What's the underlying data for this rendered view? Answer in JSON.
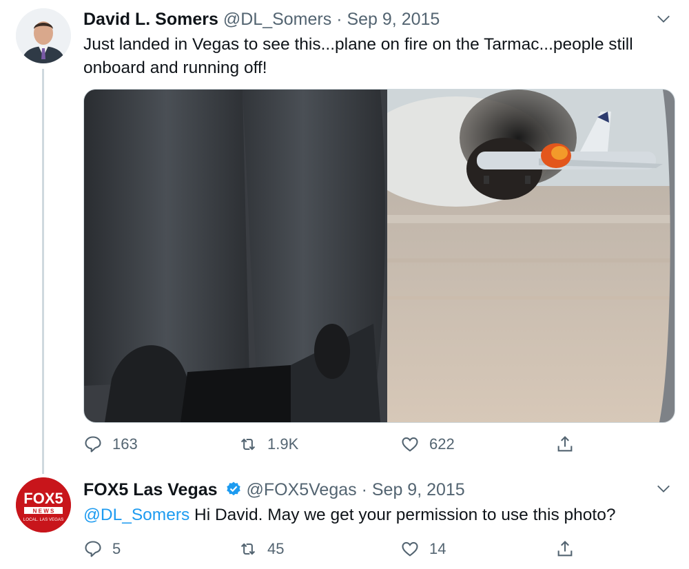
{
  "tweets": [
    {
      "author_name": "David L. Somers",
      "handle": "@DL_Somers",
      "separator": "·",
      "date": "Sep 9, 2015",
      "text": "Just landed in Vegas to see this...plane on fire on the Tarmac...people still onboard and running off!",
      "media_icon": "photo",
      "replies": "163",
      "retweets": "1.9K",
      "likes": "622"
    },
    {
      "author_name": "FOX5 Las Vegas",
      "verified_icon": "verified-badge-icon",
      "handle": "@FOX5Vegas",
      "separator": "·",
      "date": "Sep 9, 2015",
      "mention": "@DL_Somers",
      "text": " Hi David. May we get your permission to use this photo?",
      "logo": {
        "line1": "FOX5",
        "line2": "N E W S",
        "line3": "LOCAL. LAS VEGAS"
      },
      "replies": "5",
      "retweets": "45",
      "likes": "14"
    }
  ],
  "colors": {
    "accent": "#1d9bf0",
    "muted": "#536471",
    "text": "#0f1419",
    "fox_red": "#c8151b"
  }
}
